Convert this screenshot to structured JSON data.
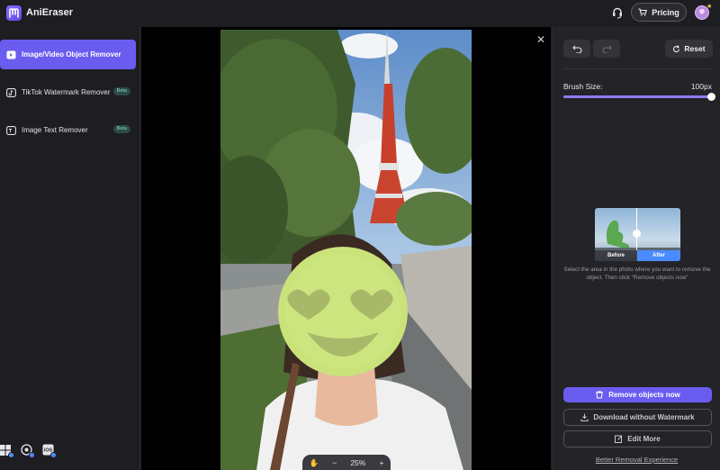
{
  "app": {
    "name": "AniEraser"
  },
  "header": {
    "pricing_label": "Pricing"
  },
  "sidebar": {
    "items": [
      {
        "label": "Image/Video Object Remover",
        "active": true,
        "badge": ""
      },
      {
        "label": "TikTok Watermark Remover",
        "active": false,
        "badge": "Beta"
      },
      {
        "label": "Image Text Remover",
        "active": false,
        "badge": "Beta"
      }
    ],
    "platforms": [
      "windows-icon",
      "mac-icon",
      "ios-icon"
    ],
    "platform_labels": {
      "ios": "iOS"
    }
  },
  "canvas": {
    "zoom": "25%",
    "zoom_minus": "−",
    "zoom_plus": "+"
  },
  "panel": {
    "reset_label": "Reset",
    "brush_label": "Brush Size:",
    "brush_value": "100px",
    "brush_level": 1.0,
    "demo": {
      "before_label": "Before",
      "after_label": "After"
    },
    "hint": "Select the area in the photo where you want to remove the object. Then click \"Remove objects now\"",
    "remove_label": "Remove objects now",
    "download_label": "Download without Watermark",
    "edit_label": "Edit More",
    "link_label": "Better Removal Experience"
  },
  "colors": {
    "accent": "#6b5cf0",
    "beta_bg": "#2b4a46",
    "beta_text": "#8fd9c9",
    "after_label": "#4a8cff"
  }
}
